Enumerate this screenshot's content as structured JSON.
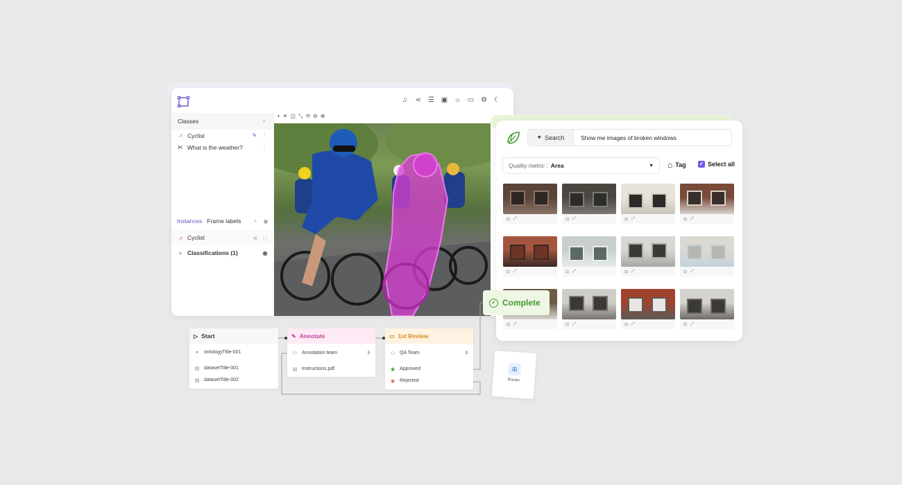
{
  "colors": {
    "accent": "#5f56c7",
    "annotate": "#c2439a",
    "review": "#d98a1d",
    "complete": "#3f9a2e",
    "mask": "#d43fd0"
  },
  "annotation": {
    "toolbar_icons": [
      "bell-icon",
      "share-icon",
      "sliders-icon",
      "save-icon",
      "sun-icon",
      "keyboard-icon",
      "settings-icon",
      "moon-icon"
    ],
    "classes": {
      "header": "Classes",
      "items": [
        {
          "label": "Cyclist",
          "icon": "polygon-icon"
        },
        {
          "label": "What is the weather?",
          "icon": "branch-icon"
        }
      ]
    },
    "instances": {
      "tab_active": "Instances",
      "tab_other": "Frame labels",
      "items": [
        {
          "label": "Cyclist"
        },
        {
          "label": "Classifications (1)"
        }
      ]
    },
    "canvas_tools": [
      "+",
      "✕",
      "◫",
      "⤡",
      "⟲",
      "⊖",
      "⊕"
    ]
  },
  "search": {
    "button_label": "Search",
    "query": "Show me images of broken windows",
    "quality_label": "Quality metric :",
    "quality_value": "Area",
    "tag_label": "Tag",
    "select_all_label": "Select all",
    "thumbnails": [
      {
        "colors": [
          "#5a4438",
          "#2e2622",
          "#8a7466"
        ]
      },
      {
        "colors": [
          "#4a4640",
          "#2c2c2a",
          "#7d7a74"
        ]
      },
      {
        "colors": [
          "#e7e4dc",
          "#2a2a28",
          "#c9c4b7"
        ]
      },
      {
        "colors": [
          "#7a4a38",
          "#3a2e2a",
          "#d7d2cc"
        ]
      },
      {
        "colors": [
          "#a4553f",
          "#6e3425",
          "#3a2a24"
        ]
      },
      {
        "colors": [
          "#c9d0cc",
          "#5d6a63",
          "#e7ecea"
        ]
      },
      {
        "colors": [
          "#d8d7d4",
          "#3a3937",
          "#a9a7a2"
        ]
      },
      {
        "colors": [
          "#dcd8d2",
          "#b9b6b0",
          "#c3d2dc"
        ]
      },
      {
        "colors": [
          "#6e5a46",
          "#3e3a36",
          "#d9d6d2"
        ]
      },
      {
        "colors": [
          "#cfcdc8",
          "#3b3935",
          "#77746f"
        ]
      },
      {
        "colors": [
          "#a1422f",
          "#e8e6e2",
          "#5c5a55"
        ]
      },
      {
        "colors": [
          "#d5d3cf",
          "#3c3a36",
          "#6e6b66"
        ]
      }
    ]
  },
  "complete": {
    "label": "Complete"
  },
  "workflow": {
    "start": {
      "title": "Start",
      "rows": [
        "ontologyTitle-001",
        "datasetTitle-001",
        "datasetTitle-002"
      ]
    },
    "annotate": {
      "title": "Annotate",
      "rows": [
        {
          "label": "Annotation team",
          "count": "3"
        },
        {
          "label": "instructions.pdf"
        }
      ]
    },
    "review": {
      "title": "1st Review",
      "rows": [
        {
          "label": "QA Team",
          "count": "3"
        },
        {
          "label": "Approved"
        },
        {
          "label": "Rejected"
        }
      ]
    },
    "router": {
      "label": "Router"
    }
  }
}
